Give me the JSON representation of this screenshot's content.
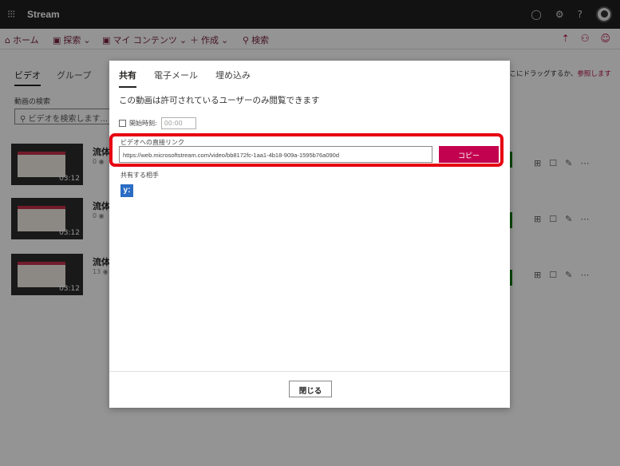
{
  "app": {
    "title": "Stream"
  },
  "nav": {
    "home": "ホーム",
    "browse": "探索",
    "my_content": "マイ コンテンツ",
    "create": "作成",
    "search": "検索"
  },
  "page": {
    "tabs": [
      "ビデオ",
      "グループ"
    ],
    "search_label": "動画の検索",
    "search_placeholder": "ビデオを検索します...",
    "drop_hint": "ここにドラッグするか、",
    "browse_link": "参照します"
  },
  "videos": [
    {
      "title": "流体",
      "views": "0",
      "duration": "03:12"
    },
    {
      "title": "流体",
      "views": "0",
      "duration": "03:12"
    },
    {
      "title": "流体",
      "views": "13",
      "duration": "03:12"
    }
  ],
  "dialog": {
    "tabs": [
      "共有",
      "電子メール",
      "埋め込み"
    ],
    "info": "この動画は許可されているユーザーのみ閲覧できます",
    "start_time_label": "開始時刻:",
    "start_time_value": "00:00",
    "link_label": "ビデオへの直接リンク",
    "link_value": "https://web.microsoftstream.com/video/bb8172fc-1aa1-4b18-909a-1595b76a090d",
    "copy_button": "コピー",
    "share_with_label": "共有する相手",
    "share_chip": "y:",
    "close_button": "閉じる"
  },
  "colors": {
    "accent": "#c3024f",
    "highlight": "#e60012",
    "topbar": "#1f1f1f"
  }
}
